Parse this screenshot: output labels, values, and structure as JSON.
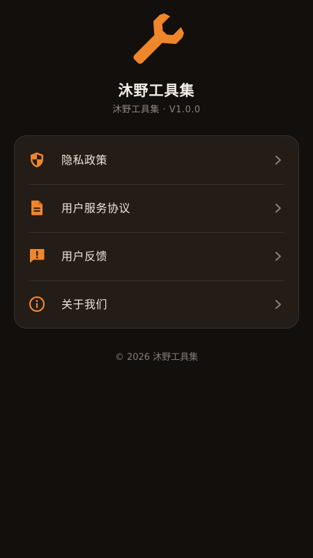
{
  "app": {
    "logo_icon": "wrench-icon",
    "name": "沐野工具集",
    "version": "沐野工具集 · V1.0.0"
  },
  "menu": {
    "items": [
      {
        "label": "隐私政策",
        "icon": "shield-icon"
      },
      {
        "label": "用户服务协议",
        "icon": "document-icon"
      },
      {
        "label": "用户反馈",
        "icon": "feedback-icon"
      },
      {
        "label": "关于我们",
        "icon": "info-icon"
      }
    ]
  },
  "footer": {
    "copyright": "© 2026 沐野工具集"
  },
  "colors": {
    "accent": "#f0862a",
    "background": "#120f0c",
    "card": "#231c17"
  }
}
